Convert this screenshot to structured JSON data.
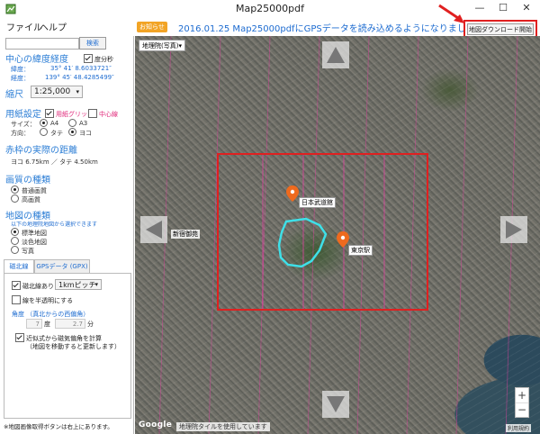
{
  "window": {
    "title": "Map25000pdf",
    "minimize": "—",
    "maximize": "☐",
    "close": "✕"
  },
  "menu": {
    "file": "ファイル",
    "help": "ヘルプ"
  },
  "search": {
    "value": "",
    "button": "検索"
  },
  "center": {
    "heading": "中心の緯度経度",
    "dms_label": "度分秒",
    "lat_label": "緯度：",
    "lat_value": "35° 41′ 8.6033721″",
    "lon_label": "経度：",
    "lon_value": "139° 45′ 48.4285499″"
  },
  "scale": {
    "heading": "縮尺",
    "value": "1:25,000"
  },
  "paper": {
    "heading": "用紙設定",
    "grid_label": "用紙グリッド",
    "centerline_label": "中心線",
    "size_label": "サイズ：",
    "size_a4": "A4",
    "size_a3": "A3",
    "dir_label": "方向：",
    "dir_portrait": "タテ",
    "dir_landscape": "ヨコ"
  },
  "distance": {
    "heading": "赤枠の実際の距離",
    "value": "ヨコ 6.75km ／ タテ 4.50km"
  },
  "quality": {
    "heading": "画質の種類",
    "normal": "普通画質",
    "high": "高画質"
  },
  "maptype": {
    "heading": "地図の種類",
    "note": "以下の地理院地図から選択できます",
    "standard": "標準地図",
    "pale": "淡色地図",
    "photo": "写真"
  },
  "tabs": {
    "magnetic": "磁北線",
    "gps": "GPSデータ (GPX)"
  },
  "magnetic": {
    "lines_label": "磁北線あり",
    "pitch": "1kmピッチ",
    "translucent_label": "線を半透明にする",
    "declination_heading": "角度 （真北からの西偏角）",
    "deg_value": "7",
    "deg_unit": "度",
    "min_value": "2.7",
    "min_unit": "分",
    "auto_label": "近似式から磁気偏角を計算",
    "auto_note": "（地図を移動すると更新します）"
  },
  "footer_note": "※地図画像取得ボタンは右上にあります。",
  "notice": {
    "badge": "お知らせ",
    "text": "2016.01.25 Map25000pdfにGPSデータを読み込めるようになりました。"
  },
  "download_button": "地図ダウンロード開始",
  "map": {
    "layer_select": "地理院(写真)",
    "label_palace": "日本武道館",
    "label_tokyo": "東京駅",
    "label_shinjuku": "新宿御苑",
    "zoom_in": "+",
    "zoom_out": "−",
    "attribution": "地理院タイルを使用しています",
    "google": "Google",
    "terms": "利用規約"
  },
  "colors": {
    "accent": "#2e7fd6",
    "frame": "#e02020",
    "grid": "#e040a0",
    "trace": "#3ee0e8"
  }
}
